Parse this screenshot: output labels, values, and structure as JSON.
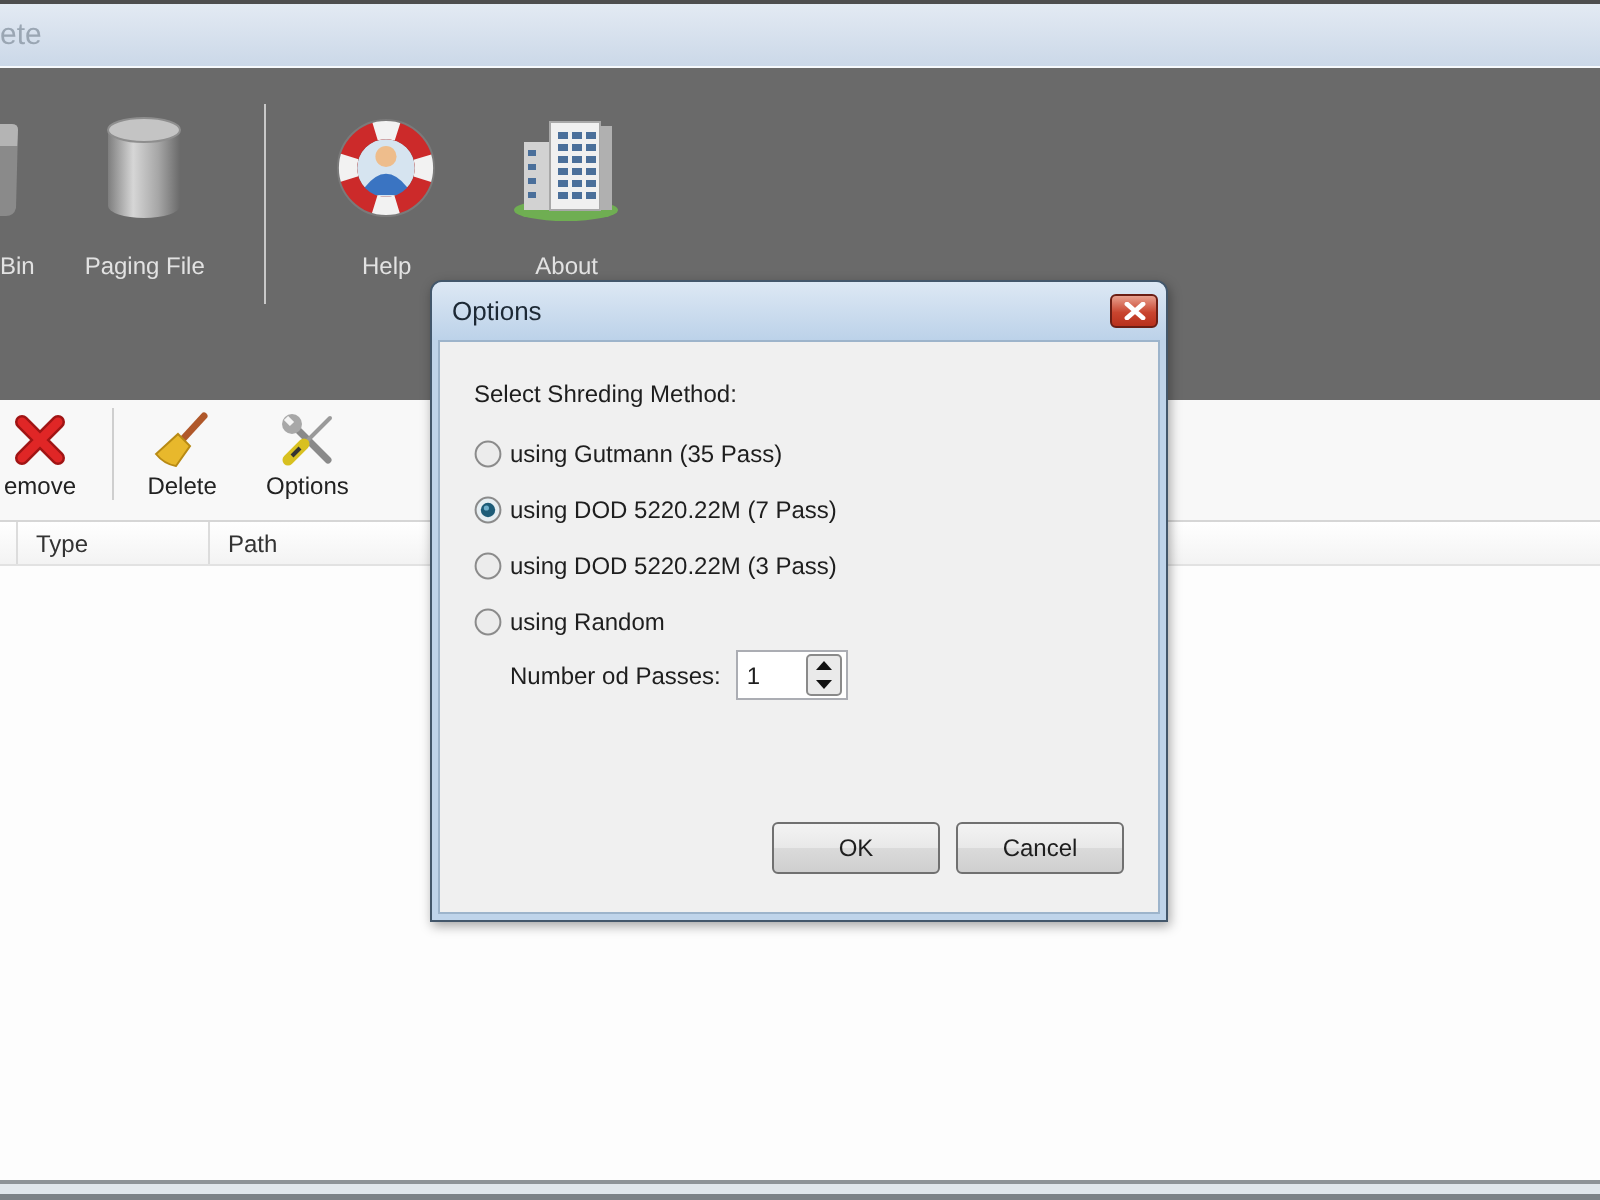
{
  "window": {
    "title": "ete"
  },
  "ribbon": {
    "groups": [
      {
        "items": [
          {
            "label": "Bin"
          },
          {
            "label": "Paging File"
          }
        ]
      },
      {
        "items": [
          {
            "label": "Help"
          },
          {
            "label": "About"
          }
        ]
      }
    ]
  },
  "toolbar": {
    "groups": [
      {
        "items": [
          {
            "label": "emove"
          }
        ]
      },
      {
        "items": [
          {
            "label": "Delete"
          },
          {
            "label": "Options"
          }
        ]
      }
    ]
  },
  "table": {
    "columns": [
      "Type",
      "Path"
    ]
  },
  "dialog": {
    "title": "Options",
    "prompt": "Select Shreding Method:",
    "methods": [
      {
        "label": "using Gutmann (35 Pass)",
        "selected": false
      },
      {
        "label": "using DOD 5220.22M (7 Pass)",
        "selected": true
      },
      {
        "label": "using DOD 5220.22M (3 Pass)",
        "selected": false
      },
      {
        "label": "using Random",
        "selected": false
      }
    ],
    "passes": {
      "label": "Number od Passes:",
      "value": "1"
    },
    "buttons": [
      "OK",
      "Cancel"
    ]
  }
}
